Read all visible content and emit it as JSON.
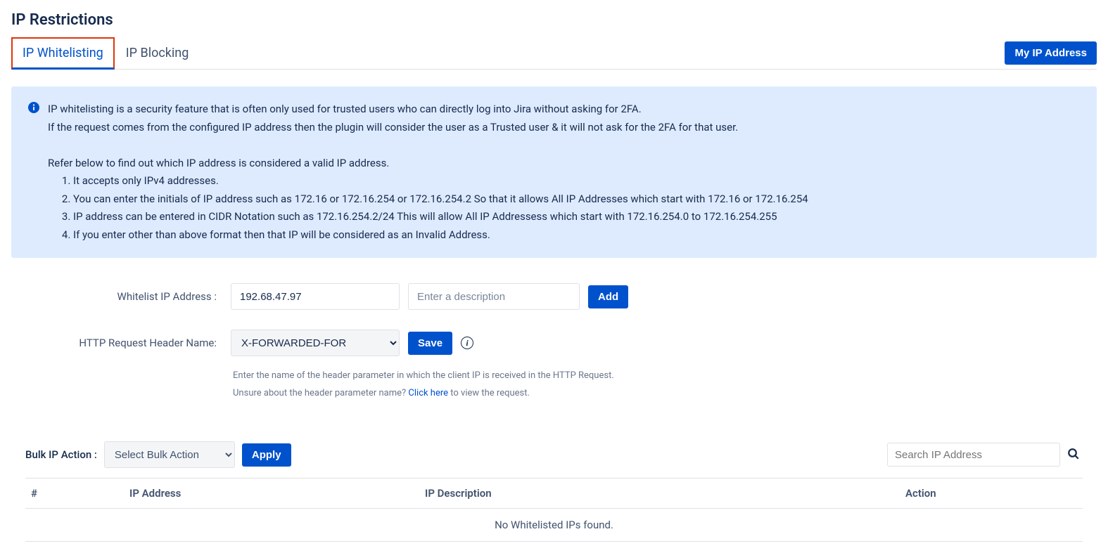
{
  "page_title": "IP Restrictions",
  "tabs": [
    {
      "label": "IP Whitelisting",
      "active": true
    },
    {
      "label": "IP Blocking",
      "active": false
    }
  ],
  "header_button": "My IP Address",
  "info": {
    "line1": "IP whitelisting is a security feature that is often only used for trusted users who can directly log into Jira without asking for 2FA.",
    "line2": "If the request comes from the configured IP address then the plugin will consider the user as a Trusted user & it will not ask for the 2FA for that user.",
    "line3": "Refer below to find out which IP address is considered a valid IP address.",
    "items": [
      "It accepts only IPv4 addresses.",
      "You can enter the initials of IP address such as 172.16 or 172.16.254 or 172.16.254.2 So that it allows All IP Addresses which start with 172.16 or 172.16.254",
      "IP address can be entered in CIDR Notation such as 172.16.254.2/24 This will allow All IP Addressess which start with 172.16.254.0 to 172.16.254.255",
      "If you enter other than above format then that IP will be considered as an Invalid Address."
    ]
  },
  "form": {
    "whitelist_label": "Whitelist IP Address :",
    "ip_value": "192.68.47.97",
    "desc_placeholder": "Enter a description",
    "add_button": "Add",
    "header_label": "HTTP Request Header Name:",
    "header_value": "X-FORWARDED-FOR",
    "save_button": "Save",
    "helper1": "Enter the name of the header parameter in which the client IP is received in the HTTP Request.",
    "helper2_a": "Unsure about the header parameter name? ",
    "helper2_link": "Click here",
    "helper2_b": " to view the request."
  },
  "bulk": {
    "label": "Bulk IP Action :",
    "select_value": "Select Bulk Action",
    "apply_button": "Apply",
    "search_placeholder": "Search IP Address"
  },
  "table": {
    "columns": [
      "#",
      "IP Address",
      "IP Description",
      "Action"
    ],
    "empty": "No Whitelisted IPs found."
  }
}
